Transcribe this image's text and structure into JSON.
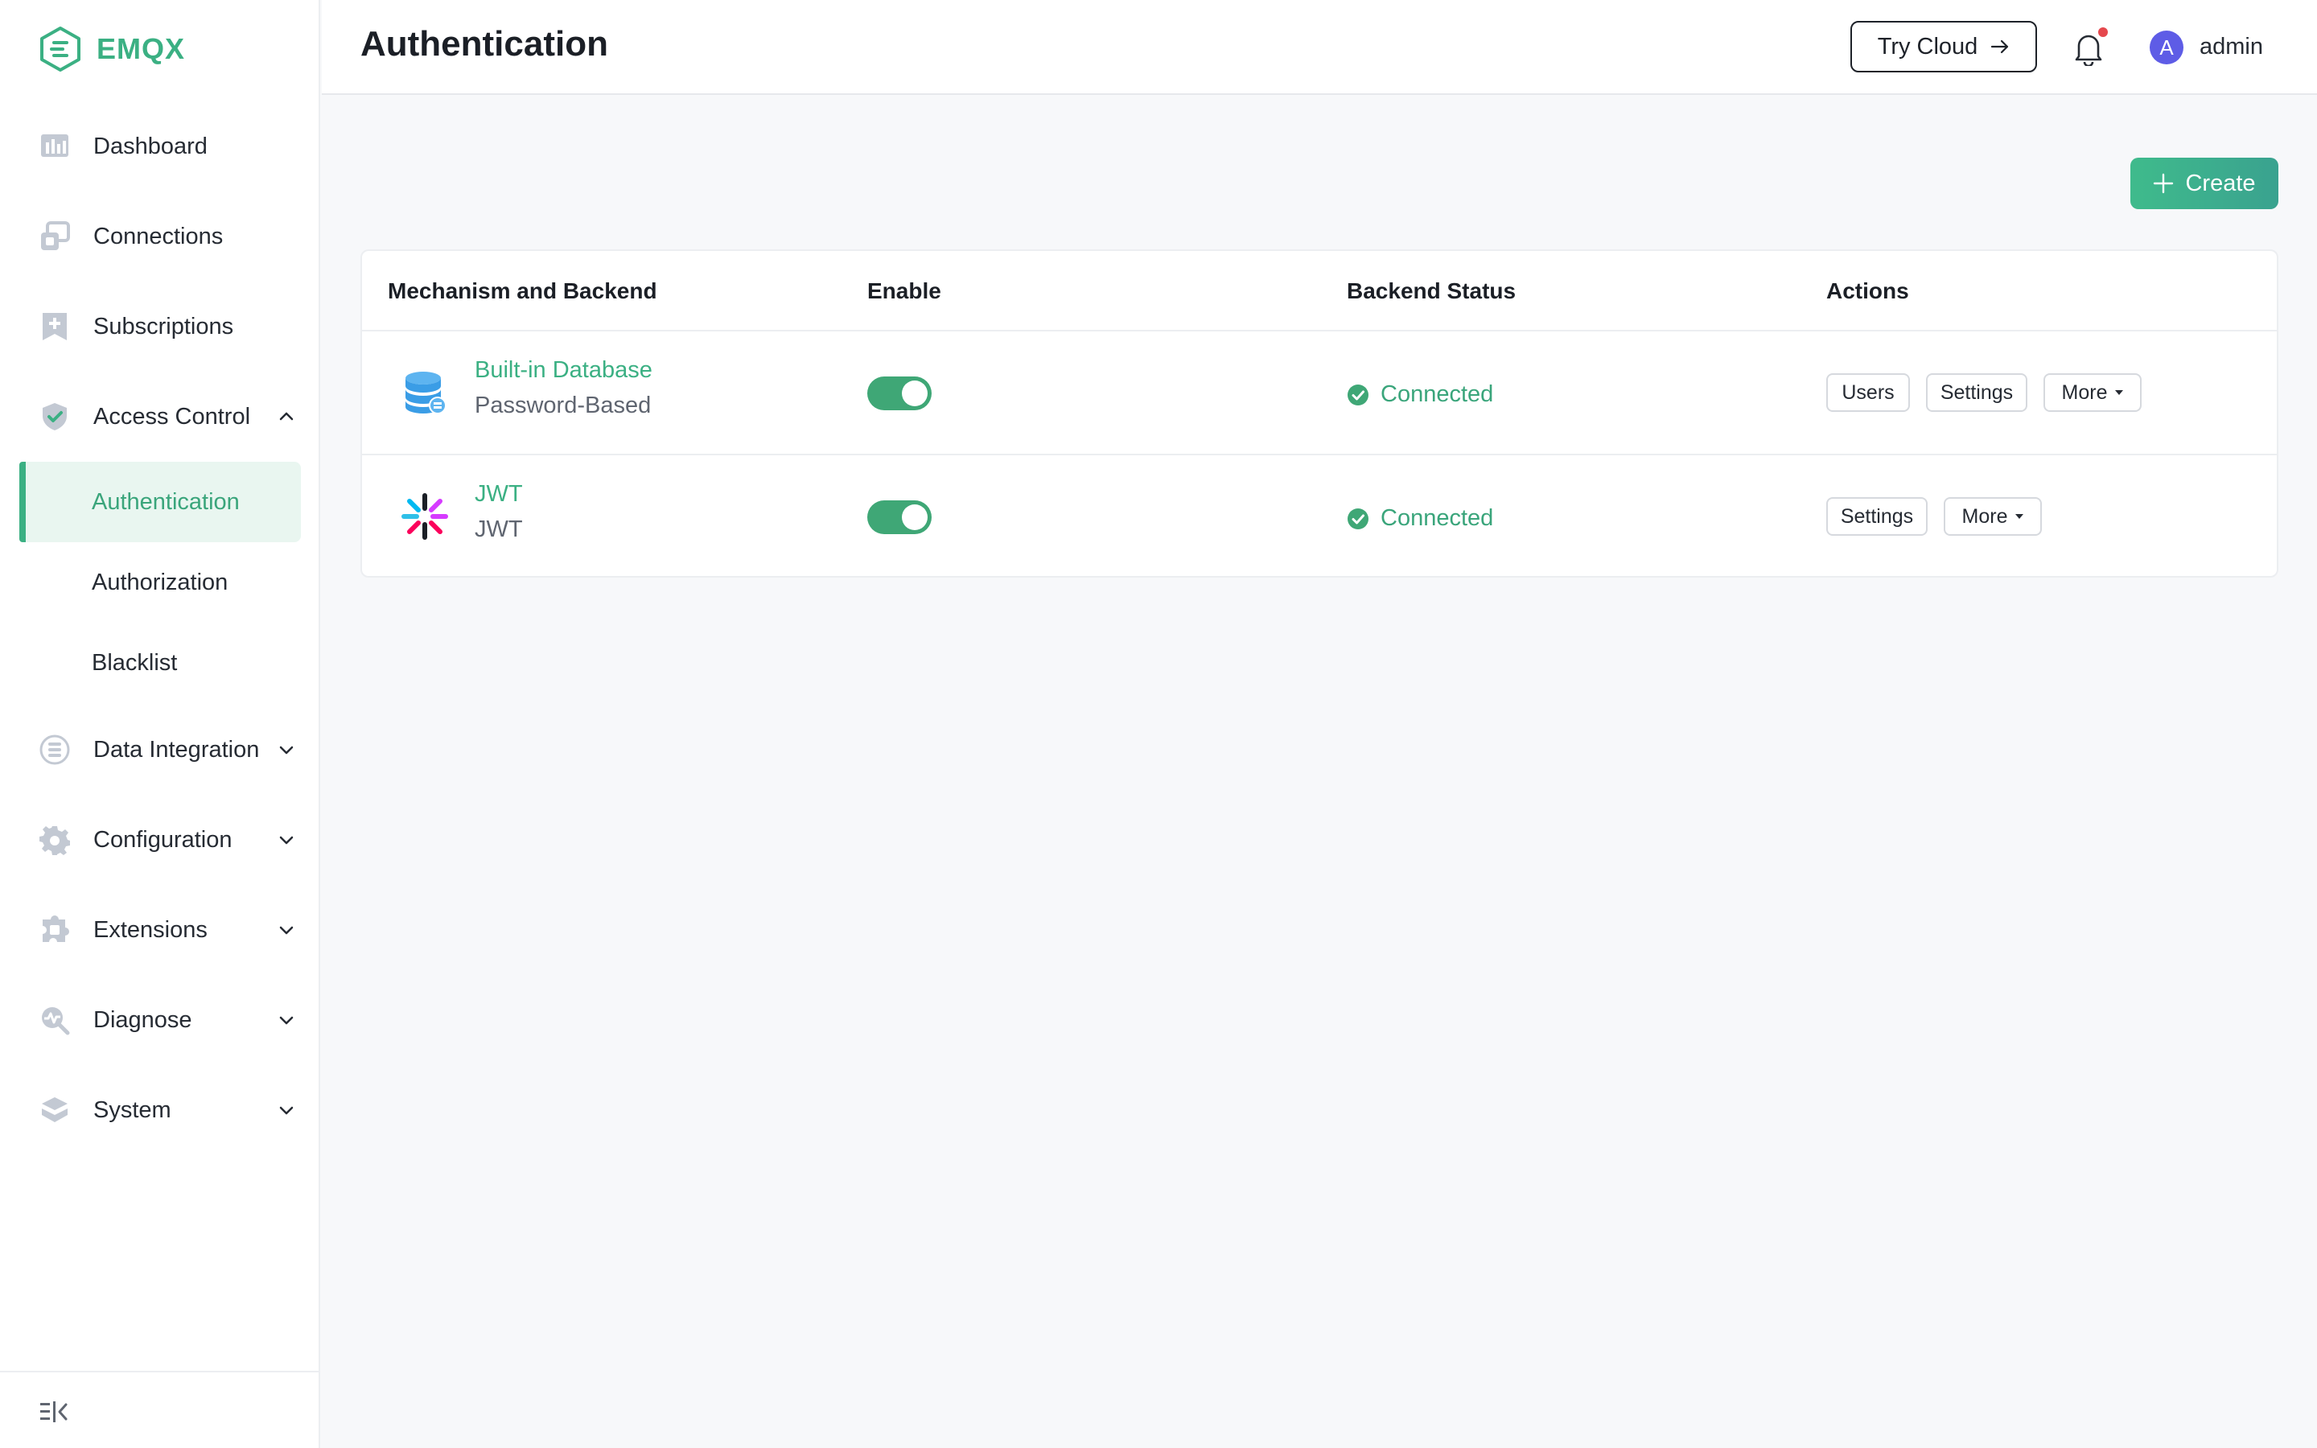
{
  "app": {
    "name": "EMQX"
  },
  "header": {
    "title": "Authentication",
    "try_cloud_label": "Try Cloud",
    "avatar_initial": "A",
    "username": "admin"
  },
  "sidebar": {
    "items": [
      {
        "label": "Dashboard",
        "icon": "dashboard-icon"
      },
      {
        "label": "Connections",
        "icon": "connections-icon"
      },
      {
        "label": "Subscriptions",
        "icon": "subscriptions-icon"
      },
      {
        "label": "Access Control",
        "icon": "shield-check-icon",
        "expanded": true
      },
      {
        "label": "Data Integration",
        "icon": "data-integration-icon"
      },
      {
        "label": "Configuration",
        "icon": "gear-icon"
      },
      {
        "label": "Extensions",
        "icon": "puzzle-icon"
      },
      {
        "label": "Diagnose",
        "icon": "diagnose-icon"
      },
      {
        "label": "System",
        "icon": "layers-icon"
      }
    ],
    "access_control_children": [
      {
        "label": "Authentication",
        "active": true
      },
      {
        "label": "Authorization",
        "active": false
      },
      {
        "label": "Blacklist",
        "active": false
      }
    ]
  },
  "toolbar": {
    "create_label": "Create"
  },
  "table": {
    "columns": [
      "Mechanism and Backend",
      "Enable",
      "Backend Status",
      "Actions"
    ],
    "rows": [
      {
        "backend": "Built-in Database",
        "mechanism": "Password-Based",
        "icon": "database-icon",
        "enabled": true,
        "status": "Connected",
        "actions": [
          "Users",
          "Settings",
          "More"
        ]
      },
      {
        "backend": "JWT",
        "mechanism": "JWT",
        "icon": "jwt-icon",
        "enabled": true,
        "status": "Connected",
        "actions": [
          "Settings",
          "More"
        ]
      }
    ]
  },
  "colors": {
    "brand": "#3bb083",
    "active_bg": "#e9f6f0",
    "toggle_on": "#3fa776",
    "avatar": "#5e5ce6",
    "notification_dot": "#e5484d"
  }
}
